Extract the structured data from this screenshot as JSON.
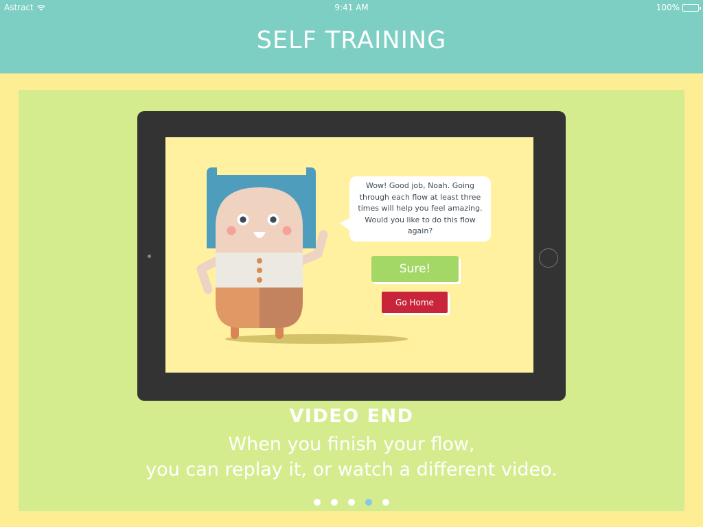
{
  "status_bar": {
    "carrier": "Astract",
    "time": "9:41 AM",
    "battery": "100%"
  },
  "header": {
    "title": "SELF TRAINING"
  },
  "tablet_screen": {
    "speech": "Wow! Good job, Noah. Going through each flow at least three times will help you feel amazing. Would you like to do this flow again?",
    "sure_label": "Sure!",
    "home_label": "Go Home"
  },
  "caption": {
    "title": "VIDEO END",
    "line1": "When you finish your flow,",
    "line2": "you can replay it, or watch a different video."
  },
  "pager": {
    "count": 5,
    "active_index": 3
  },
  "colors": {
    "header": "#7dcfc4",
    "background": "#fdee93",
    "panel": "#d4ec8d",
    "tablet": "#333333",
    "sure_button": "#a4d866",
    "home_button": "#c9253a",
    "active_dot": "#85c9e6"
  }
}
